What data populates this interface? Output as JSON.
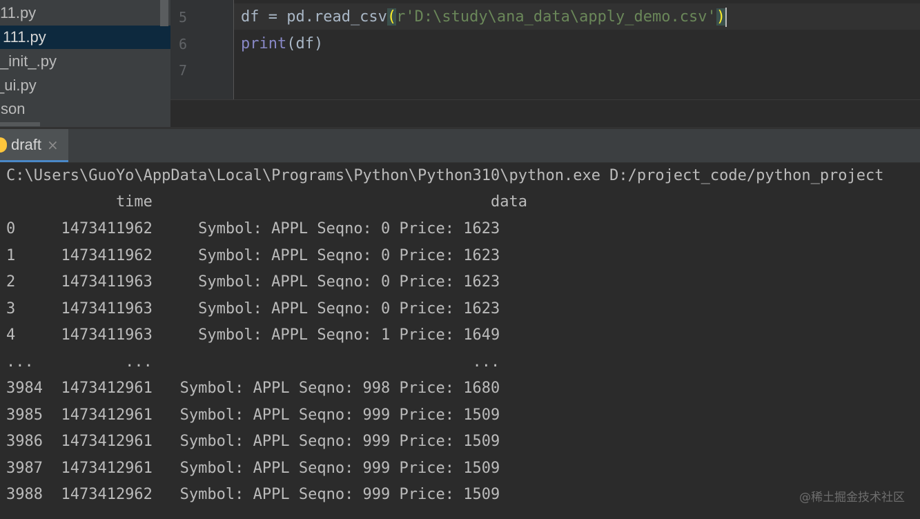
{
  "project_tree": {
    "items": [
      "11.py",
      "111.py",
      "_init_.py",
      "_ui.py",
      ".json"
    ],
    "selected_index": 1
  },
  "editor": {
    "line_numbers": [
      "5",
      "6",
      "7"
    ],
    "line5": {
      "var": "df = pd.read_csv",
      "open_paren": "(",
      "string": "r'D:\\study\\ana_data\\apply_demo.csv'",
      "close_paren": ")"
    },
    "line6": {
      "func": "print",
      "args": "(df)"
    }
  },
  "run_panel": {
    "tab_label": "draft",
    "close_glyph": "×",
    "command": "C:\\Users\\GuoYo\\AppData\\Local\\Programs\\Python\\Python310\\python.exe D:/project_code/python_project",
    "header": "            time                                     data",
    "rows": [
      "0     1473411962     Symbol: APPL Seqno: 0 Price: 1623",
      "1     1473411962     Symbol: APPL Seqno: 0 Price: 1623",
      "2     1473411963     Symbol: APPL Seqno: 0 Price: 1623",
      "3     1473411963     Symbol: APPL Seqno: 0 Price: 1623",
      "4     1473411963     Symbol: APPL Seqno: 1 Price: 1649",
      "...          ...                                   ...",
      "3984  1473412961   Symbol: APPL Seqno: 998 Price: 1680",
      "3985  1473412961   Symbol: APPL Seqno: 999 Price: 1509",
      "3986  1473412961   Symbol: APPL Seqno: 999 Price: 1509",
      "3987  1473412961   Symbol: APPL Seqno: 999 Price: 1509",
      "3988  1473412962   Symbol: APPL Seqno: 999 Price: 1509"
    ]
  },
  "watermark": "@稀土掘金技术社区"
}
